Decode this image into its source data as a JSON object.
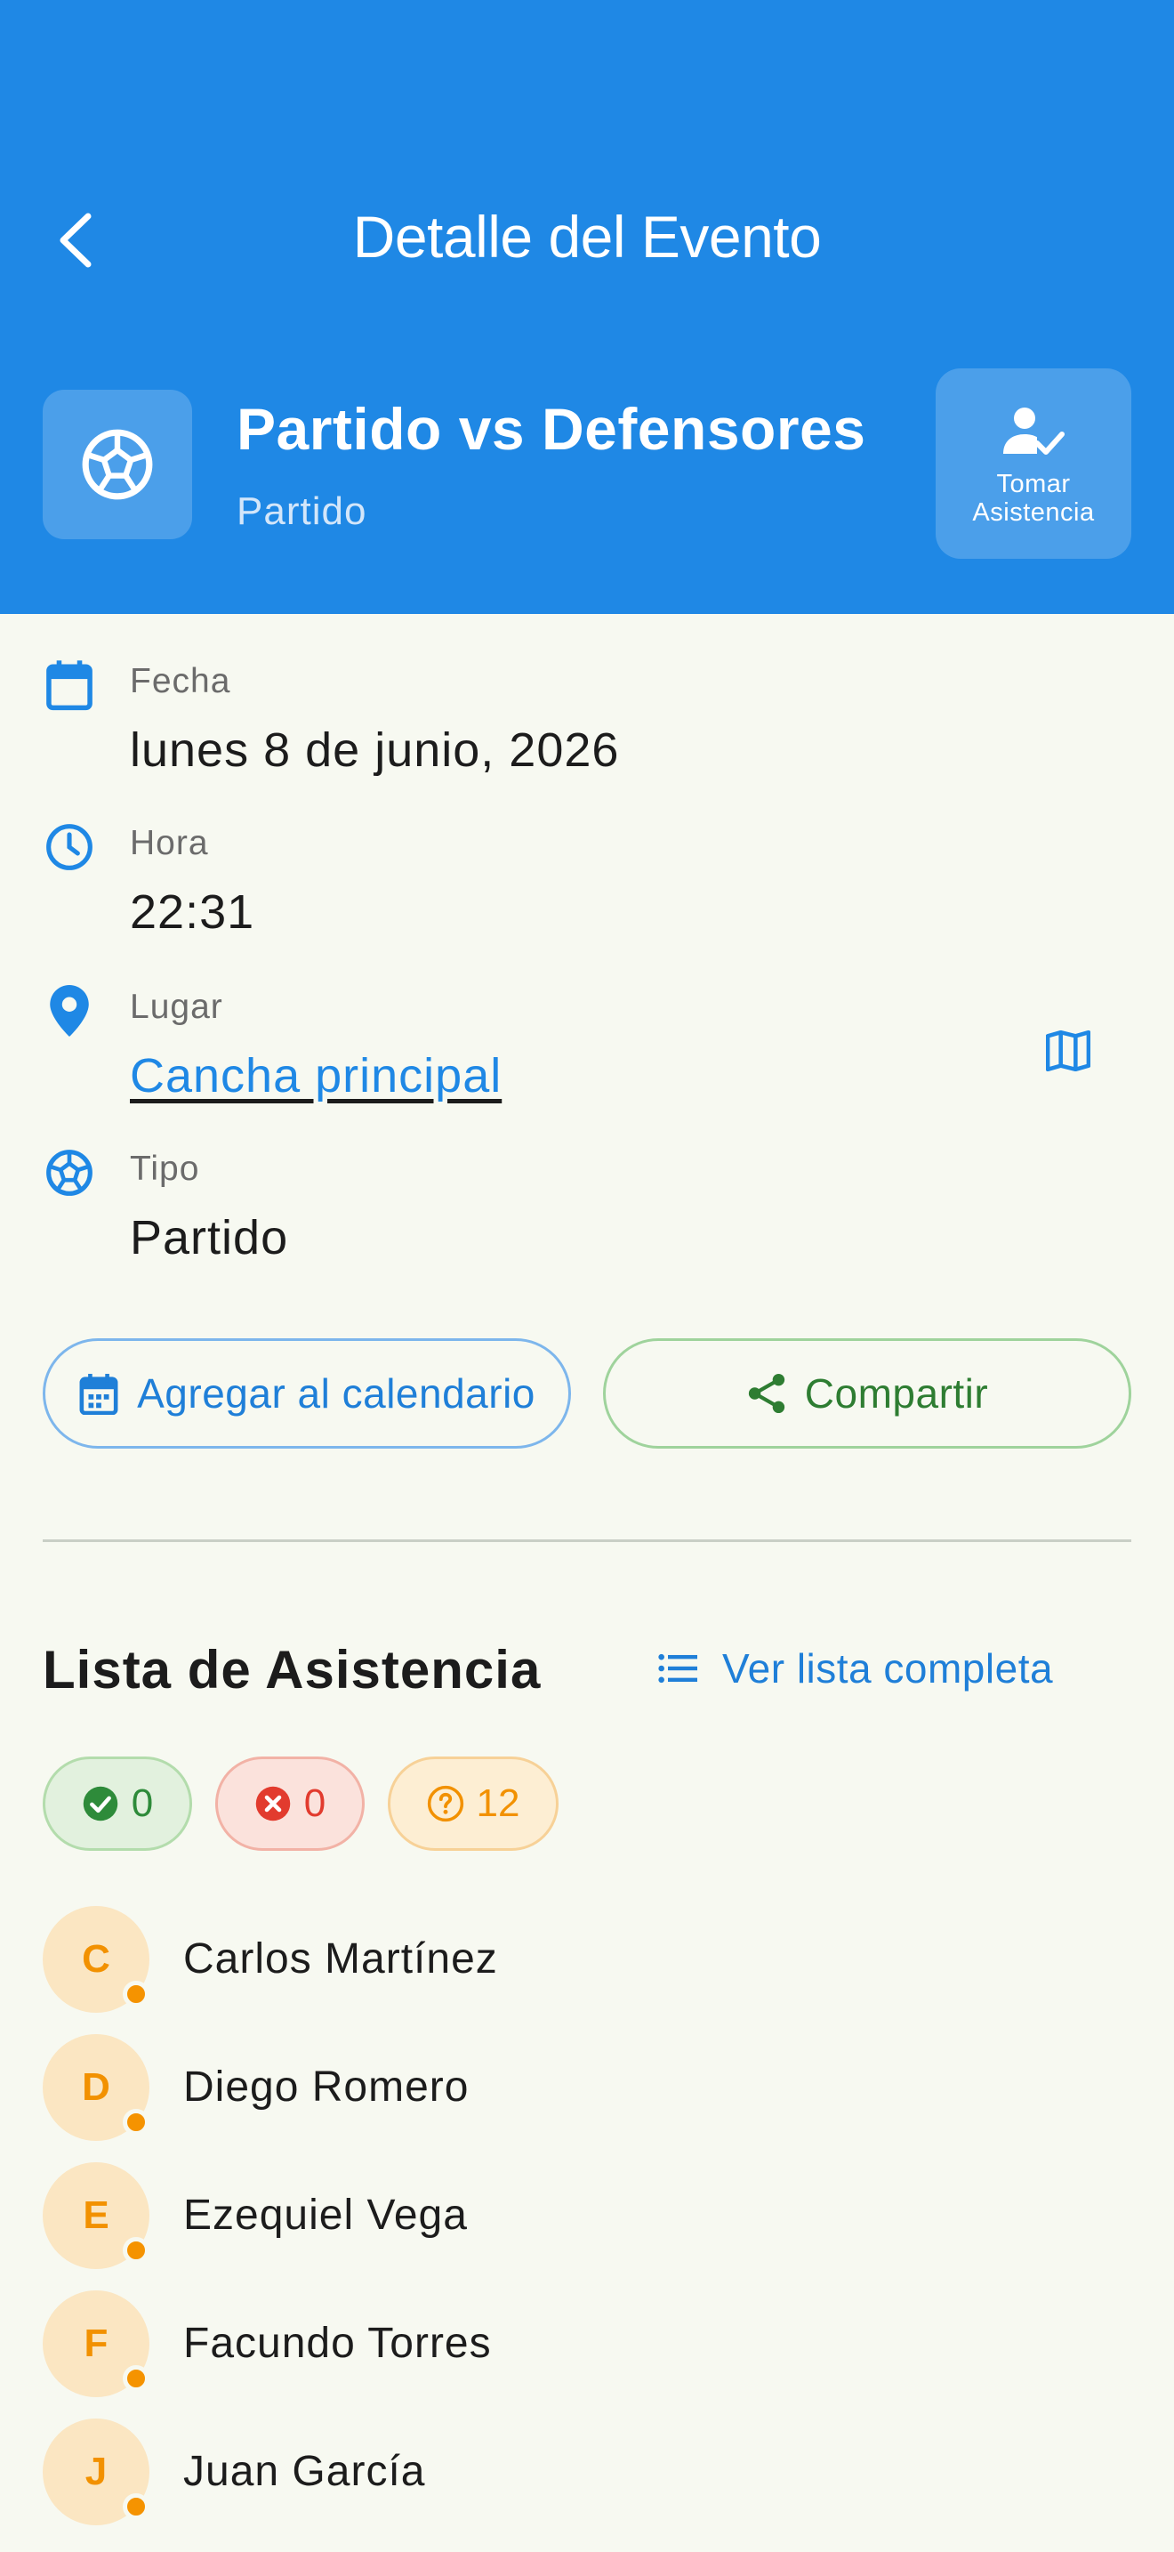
{
  "header": {
    "title": "Detalle del Evento",
    "event_name": "Partido vs Defensores",
    "event_type": "Partido",
    "attendance_button_label": "Tomar Asistencia",
    "background_color": "#1f88e5"
  },
  "details": {
    "date": {
      "label": "Fecha",
      "value": "lunes 8 de junio, 2026",
      "icon": "calendar-icon"
    },
    "time": {
      "label": "Hora",
      "value": "22:31",
      "icon": "clock-icon"
    },
    "place": {
      "label": "Lugar",
      "value": "Cancha principal",
      "icon": "location-pin-icon",
      "action_icon": "map-icon"
    },
    "type": {
      "label": "Tipo",
      "value": "Partido",
      "icon": "soccer-ball-icon"
    }
  },
  "actions": {
    "add_calendar_label": "Agregar al calendario",
    "share_label": "Compartir"
  },
  "attendance": {
    "title": "Lista de Asistencia",
    "view_all_label": "Ver lista completa",
    "counts": {
      "present": "0",
      "absent": "0",
      "pending": "12"
    },
    "members": [
      {
        "initial": "C",
        "name": "Carlos Martínez"
      },
      {
        "initial": "D",
        "name": "Diego Romero"
      },
      {
        "initial": "E",
        "name": "Ezequiel Vega"
      },
      {
        "initial": "F",
        "name": "Facundo Torres"
      },
      {
        "initial": "J",
        "name": "Juan García"
      }
    ]
  }
}
